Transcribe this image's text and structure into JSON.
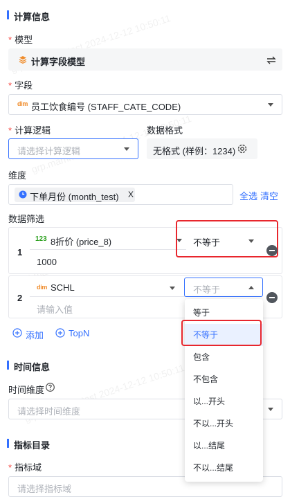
{
  "sections": {
    "calc_info": "计算信息",
    "time_info": "时间信息",
    "metric_catalog": "指标目录"
  },
  "model": {
    "label": "模型",
    "required": "*",
    "value": "计算字段模型"
  },
  "field": {
    "label": "字段",
    "required": "*",
    "tag": "dim",
    "value": "员工饮食编号 (STAFF_CATE_CODE)"
  },
  "calc_logic": {
    "label": "计算逻辑",
    "required": "*",
    "placeholder": "请选择计算逻辑"
  },
  "data_format": {
    "label": "数据格式",
    "value": "无格式 (样例：1234)"
  },
  "dimension": {
    "label": "维度",
    "tag_label": "下单月份 (month_test)",
    "tag_close": "X",
    "select_all": "全选",
    "clear": "清空"
  },
  "filter": {
    "label": "数据筛选",
    "rows": [
      {
        "index": "1",
        "tag": "123",
        "field": "8折价 (price_8)",
        "operator": "不等于",
        "value": "1000"
      },
      {
        "index": "2",
        "tag": "dim",
        "field": "SCHL",
        "operator": "不等于",
        "value_placeholder": "请输入值"
      }
    ],
    "add_label": "添加",
    "topn_label": "TopN"
  },
  "time": {
    "label": "时间维度",
    "placeholder": "请选择时间维度"
  },
  "metric_domain": {
    "label": "指标域",
    "required": "*",
    "placeholder": "请选择指标域"
  },
  "operator_menu": {
    "items": [
      "等于",
      "不等于",
      "包含",
      "不包含",
      "以...开头",
      "不以...开头",
      "以...结尾",
      "不以...结尾"
    ],
    "selected": "不等于"
  },
  "watermark": "grp.mammut_test 2024-12-12 10:50:11",
  "colors": {
    "accent": "#3370ff",
    "required": "#f54a45",
    "highlight_border": "#e8262d",
    "dim_tag": "#f08c2b",
    "num_tag": "#2ea121"
  }
}
